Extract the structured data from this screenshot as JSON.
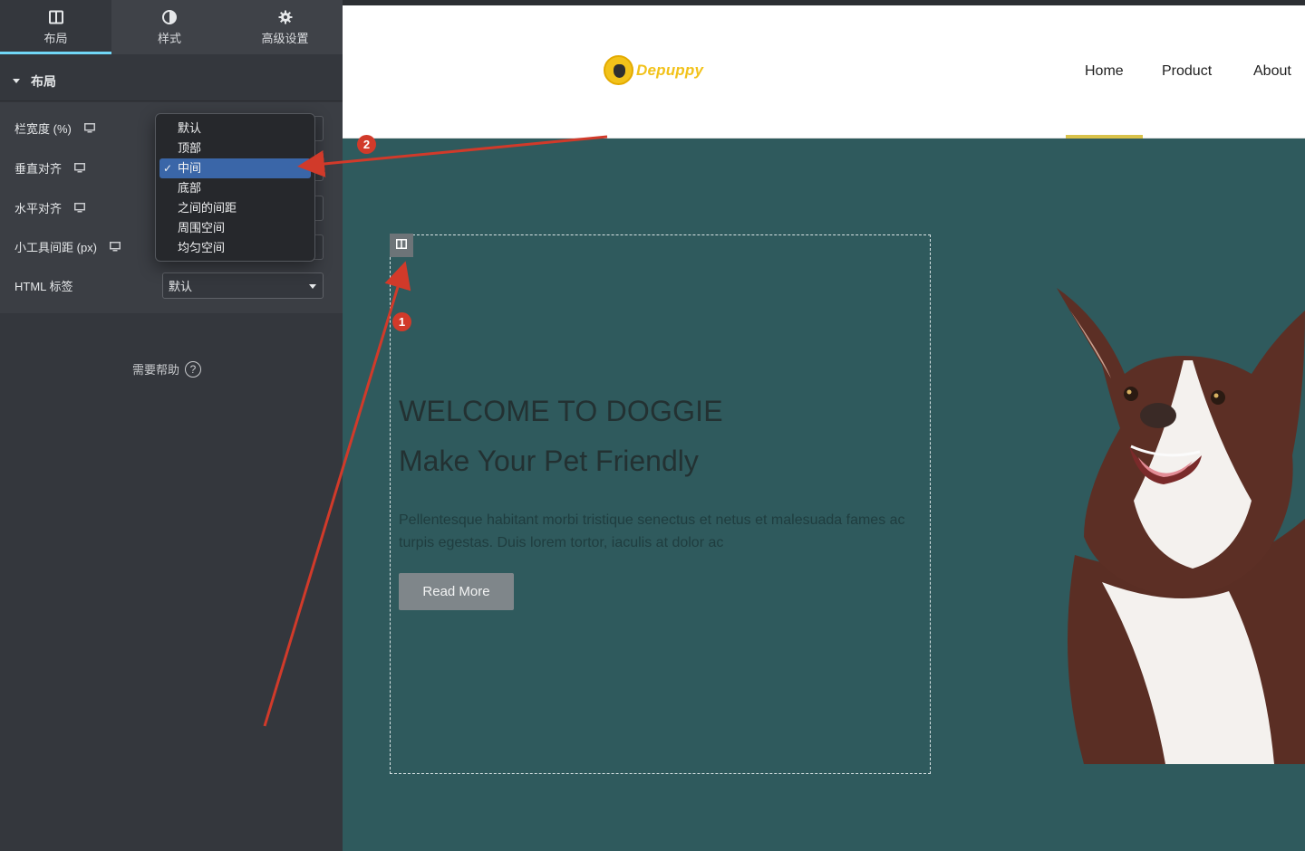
{
  "panel": {
    "tabs": [
      {
        "label": "布局",
        "icon": "columns-icon",
        "active": true
      },
      {
        "label": "样式",
        "icon": "half-circle-icon",
        "active": false
      },
      {
        "label": "高级设置",
        "icon": "gear-icon",
        "active": false
      }
    ],
    "section_title": "布局",
    "controls": {
      "column_width_label": "栏宽度 (%)",
      "vertical_align_label": "垂直对齐",
      "horizontal_align_label": "水平对齐",
      "widget_spacing_label": "小工具间距 (px)",
      "html_tag_label": "HTML 标签",
      "html_tag_value": "默认"
    },
    "dropdown": {
      "options": [
        "默认",
        "顶部",
        "中间",
        "底部",
        "之间的间距",
        "周围空间",
        "均匀空间"
      ],
      "selected": "中间",
      "check": "✓"
    },
    "help_label": "需要帮助",
    "help_icon_glyph": "?",
    "collapse_glyph": "‹"
  },
  "preview": {
    "logo_text": "Depuppy",
    "nav": {
      "home": "Home",
      "product": "Product",
      "about": "About"
    },
    "nav_active": "Home",
    "accent_color": "#d9c24a",
    "hero_bg": "#2f5a5d",
    "headline": "WELCOME TO DOGGIE",
    "subheadline": "Make Your Pet Friendly",
    "paragraph": "Pellentesque habitant morbi tristique senectus et netus et malesuada fames ac turpis egestas. Duis lorem tortor, iaculis at dolor ac",
    "button_label": "Read More"
  },
  "annotations": {
    "badge_1": "1",
    "badge_2": "2",
    "arrow_color": "#d13a2a"
  }
}
